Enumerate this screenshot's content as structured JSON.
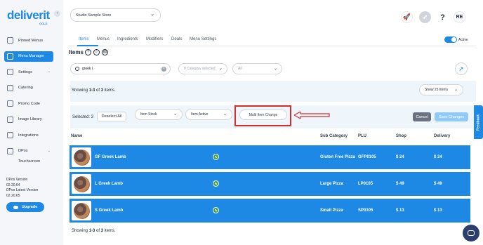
{
  "brand": {
    "name": "deliverit",
    "sub": "GOLD"
  },
  "sidebar": {
    "items": [
      {
        "label": "Pinned Menus",
        "icon": "pin-icon"
      },
      {
        "label": "Menu Manager",
        "icon": "menu-icon"
      },
      {
        "label": "Settings",
        "icon": "gear-icon"
      },
      {
        "label": "Catering",
        "icon": "catering-icon"
      },
      {
        "label": "Promo Code",
        "icon": "promo-icon"
      },
      {
        "label": "Image Library",
        "icon": "image-icon"
      },
      {
        "label": "Integrations",
        "icon": "integrations-icon"
      },
      {
        "label": "DPos",
        "icon": "dpos-icon"
      }
    ],
    "sub_item": "Touchscreen",
    "version_label": "DPos Version",
    "version_value": "02.20.64",
    "latest_label": "DPos Latest Version",
    "latest_value": "02.20.65",
    "upgrade": "Upgrade"
  },
  "header": {
    "store": "Studio Sample Store",
    "avatar": "RE",
    "help": "?"
  },
  "tabs": [
    "Items",
    "Menus",
    "Ingredients",
    "Modifiers",
    "Deals",
    "Menu Settings"
  ],
  "active_toggle": "Active",
  "page_title": "Items",
  "search": {
    "value": "greek l"
  },
  "filters": {
    "category": "0 Category selected",
    "status": "All"
  },
  "showing": {
    "prefix": "Showing ",
    "range": "1-3",
    "of": " of ",
    "total": "3",
    "suffix": " items."
  },
  "per_page": "Show 25 Items",
  "bulk": {
    "selected": "Selected: 3",
    "deselect": "Deselect All",
    "stock": "Item Stock",
    "active": "Item Active",
    "multi": "Multi Item Change",
    "cancel": "Cancel",
    "save": "Save Changes"
  },
  "table": {
    "headers": [
      "Name",
      "Sub Category",
      "PLU",
      "Shop",
      "Delivery"
    ],
    "rows": [
      {
        "name": "GF Greek Lamb",
        "sub": "Gluten Free Pizza",
        "plu": "GFP0105",
        "shop": "$ 24",
        "delivery": "$ 24"
      },
      {
        "name": "L Greek Lamb",
        "sub": "Large Pizza",
        "plu": "LP0105",
        "shop": "$ 49",
        "delivery": "$ 49"
      },
      {
        "name": "S Greek Lamb",
        "sub": "Small Pizza",
        "plu": "SP0105",
        "shop": "$ 13",
        "delivery": "$ 13"
      }
    ]
  },
  "feedback": "Feedback",
  "colors": {
    "accent": "#1e88e5",
    "highlight": "#d32f2f"
  }
}
